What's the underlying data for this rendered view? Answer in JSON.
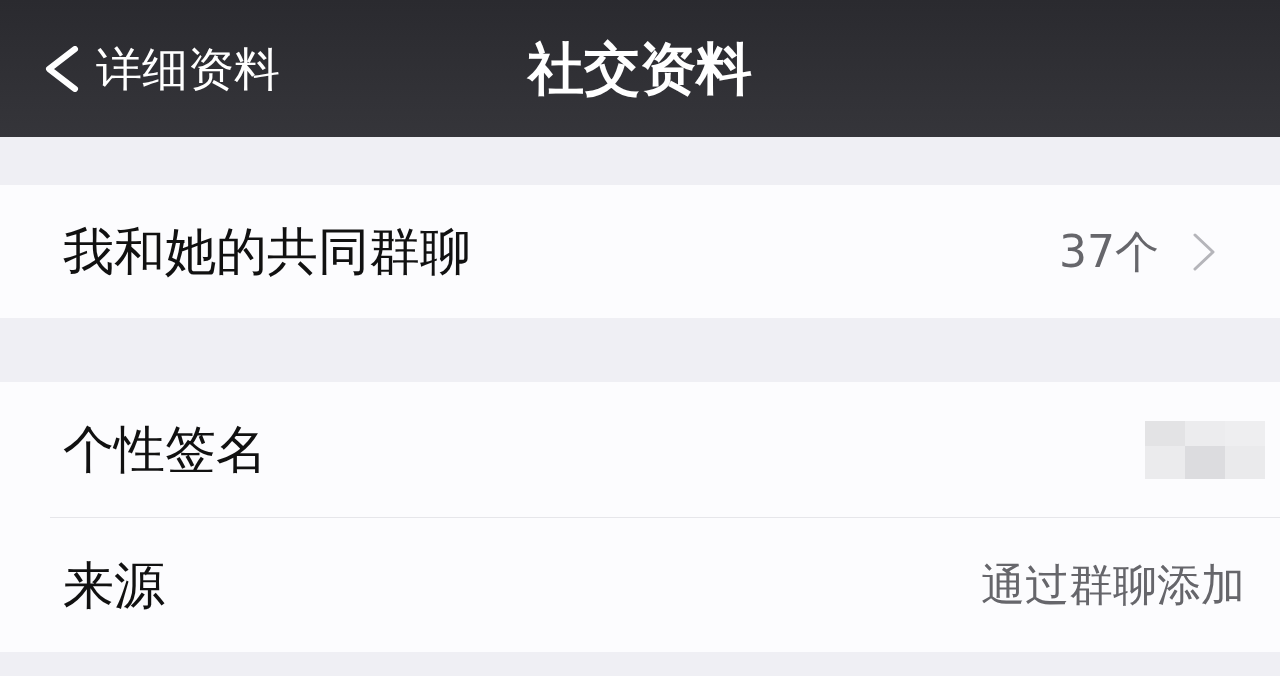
{
  "nav_bar": {
    "back_label": "详细资料",
    "title": "社交资料"
  },
  "sections": [
    {
      "rows": [
        {
          "kind": "link",
          "label": "我和她的共同群聊",
          "value": "37个"
        }
      ]
    },
    {
      "rows": [
        {
          "kind": "mosaic",
          "label": "个性签名"
        },
        {
          "kind": "text",
          "label": "来源",
          "value": "通过群聊添加"
        }
      ]
    }
  ]
}
